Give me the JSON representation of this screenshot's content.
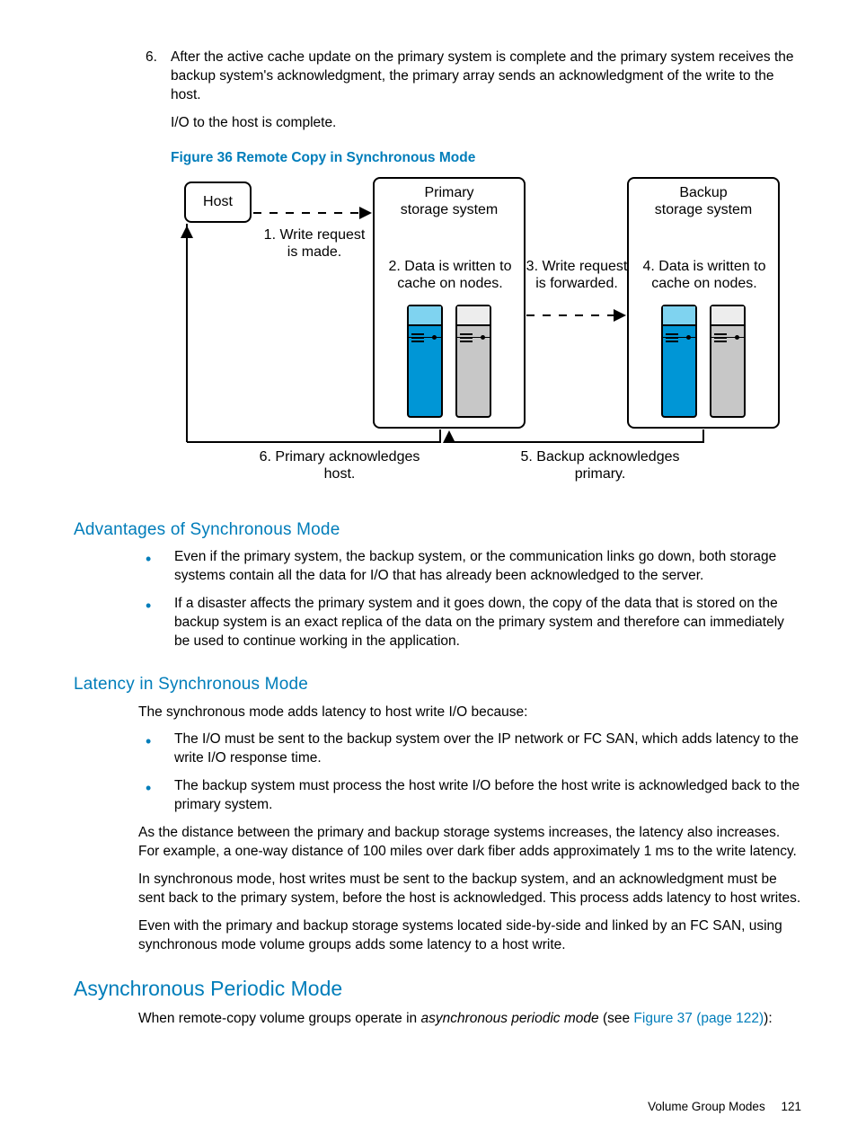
{
  "step": {
    "number": "6.",
    "text": "After the active cache update on the primary system is complete and the primary system receives the backup system's acknowledgment, the primary array sends an acknowledgment of the write to the host.",
    "text2": "I/O to the host is complete."
  },
  "figure": {
    "caption": "Figure 36 Remote Copy in Synchronous Mode",
    "host": "Host",
    "primary_label1": "Primary",
    "primary_label2": "storage system",
    "backup_label1": "Backup",
    "backup_label2": "storage system",
    "step1a": "1. Write request",
    "step1b": "is made.",
    "step2a": "2. Data is written to",
    "step2b": "cache on nodes.",
    "step3a": "3. Write request",
    "step3b": "is forwarded.",
    "step4a": "4. Data is written to",
    "step4b": "cache on nodes.",
    "step5a": "5. Backup acknowledges",
    "step5b": "primary.",
    "step6a": "6. Primary acknowledges",
    "step6b": "host."
  },
  "advantages": {
    "heading": "Advantages of Synchronous Mode",
    "bullets": [
      "Even if the primary system, the backup system, or the communication links go down, both storage systems contain all the data for I/O that has already been acknowledged to the server.",
      "If a disaster affects the primary system and it goes down, the copy of the data that is stored on the backup system is an exact replica of the data on the primary system and therefore can immediately be used to continue working in the application."
    ]
  },
  "latency": {
    "heading": "Latency in Synchronous Mode",
    "intro": "The synchronous mode adds latency to host write I/O because:",
    "bullets": [
      "The I/O must be sent to the backup system over the IP network or FC SAN, which adds latency to the write I/O response time.",
      "The backup system must process the host write I/O before the host write is acknowledged back to the primary system."
    ],
    "p1": "As the distance between the primary and backup storage systems increases, the latency also increases. For example, a one-way distance of 100 miles over dark fiber adds approximately 1 ms to the write latency.",
    "p2": "In synchronous mode, host writes must be sent to the backup system, and an acknowledgment must be sent back to the primary system, before the host is acknowledged. This process adds latency to host writes.",
    "p3": "Even with the primary and backup storage systems located side-by-side and linked by an FC SAN, using synchronous mode volume groups adds some latency to a host write."
  },
  "async": {
    "heading": "Asynchronous Periodic Mode",
    "text_pre": "When remote-copy volume groups operate in ",
    "term": "asynchronous periodic mode",
    "text_mid": " (see ",
    "xref": "Figure 37 (page 122)",
    "text_end": "):"
  },
  "footer": {
    "section": "Volume Group Modes",
    "page": "121"
  }
}
